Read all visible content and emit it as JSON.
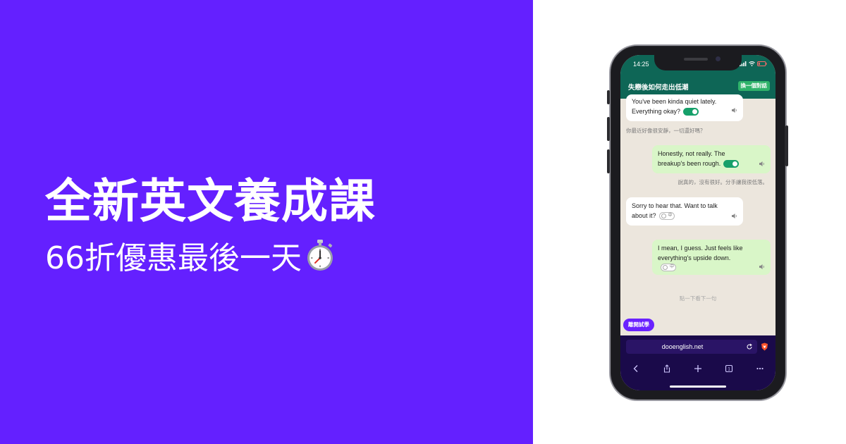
{
  "promo": {
    "headline": "全新英文養成課",
    "subheadline": "66折優惠最後一天",
    "emoji": "stopwatch-icon",
    "background_color": "#6420ff"
  },
  "phone": {
    "status_bar": {
      "time": "14:25"
    },
    "app": {
      "title": "失戀後如何走出低潮",
      "switch_button": "換一個對話",
      "accent_color": "#0e6656"
    },
    "messages": [
      {
        "side": "incoming",
        "text_line1": "You've been kinda quiet lately.",
        "text_line2": "Everything okay?",
        "translation": "你最近好像很安靜，一切還好嗎？",
        "translation_on": true
      },
      {
        "side": "outgoing",
        "text_line1": "Honestly, not really. The",
        "text_line2": "breakup's been rough.",
        "translation": "說真的，沒有很好。分手讓我很低落。",
        "translation_on": true
      },
      {
        "side": "incoming",
        "text_line1": "Sorry to hear that. Want to talk",
        "text_line2": "about it?",
        "translation_on": false
      },
      {
        "side": "outgoing",
        "text_line1": "I mean, I guess. Just feels like",
        "text_line2": "everything's upside down.",
        "translation_on": false
      }
    ],
    "tap_hint": "點一下看下一句",
    "leave_button": "離開試學",
    "browser": {
      "url": "dooenglish.net",
      "toolbar_icons": [
        "back-icon",
        "share-icon",
        "new-tab-icon",
        "tabs-icon",
        "more-icon"
      ],
      "tabs_count": "1"
    }
  }
}
